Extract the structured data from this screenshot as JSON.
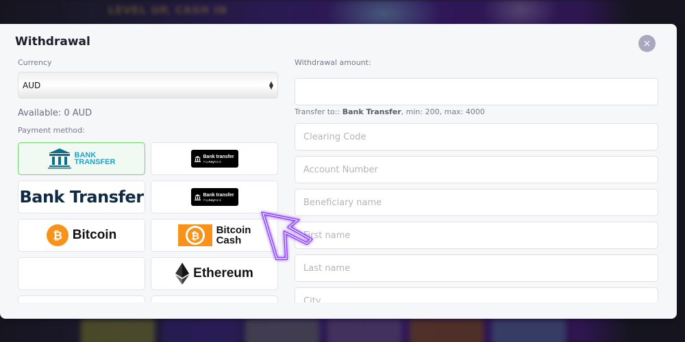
{
  "background": {
    "banner_text": "LEVEL UP, CASH IN"
  },
  "modal": {
    "title": "Withdrawal",
    "close_label": "×",
    "left": {
      "currency_label": "Currency",
      "currency_value": "AUD",
      "available_text": "Available: 0 AUD",
      "payment_method_label": "Payment method:",
      "methods": [
        {
          "id": "bank-transfer",
          "line1": "BANK",
          "line2": "TRANSFER",
          "selected": true
        },
        {
          "id": "payanybank-1",
          "line1": "Bank transfer",
          "line2_pre": "Pay",
          "line2_bold": "Any",
          "line2_post": "Bank",
          "selected": false
        },
        {
          "id": "bank-transfer-text",
          "label": "Bank Transfer",
          "selected": false
        },
        {
          "id": "payanybank-2",
          "line1": "Bank transfer",
          "line2_pre": "Pay",
          "line2_bold": "Any",
          "line2_post": "Bank",
          "selected": false
        },
        {
          "id": "bitcoin",
          "label": "Bitcoin",
          "symbol": "₿",
          "selected": false
        },
        {
          "id": "bitcoin-cash",
          "line1": "Bitcoin",
          "line2": "Cash",
          "symbol": "₿",
          "selected": false
        },
        {
          "id": "empty",
          "label": "",
          "selected": false
        },
        {
          "id": "ethereum",
          "label": "Ethereum",
          "selected": false
        }
      ]
    },
    "right": {
      "amount_label": "Withdrawal amount:",
      "amount_value": "",
      "hint_prefix": "Transfer to:: ",
      "hint_method": "Bank Transfer",
      "hint_suffix": ", min: 200, max: 4000",
      "fields": [
        {
          "name": "clearing-code",
          "placeholder": "Clearing Code"
        },
        {
          "name": "account-number",
          "placeholder": "Account Number"
        },
        {
          "name": "beneficiary-name",
          "placeholder": "Beneficiary name"
        },
        {
          "name": "first-name",
          "placeholder": "First name"
        },
        {
          "name": "last-name",
          "placeholder": "Last name"
        },
        {
          "name": "city",
          "placeholder": "City"
        }
      ]
    }
  },
  "colors": {
    "selected_border": "#6fd46a",
    "bank_blue": "#19a6d6",
    "bitcoin_orange": "#f7931a",
    "annotation_purple": "#8a3cff"
  }
}
